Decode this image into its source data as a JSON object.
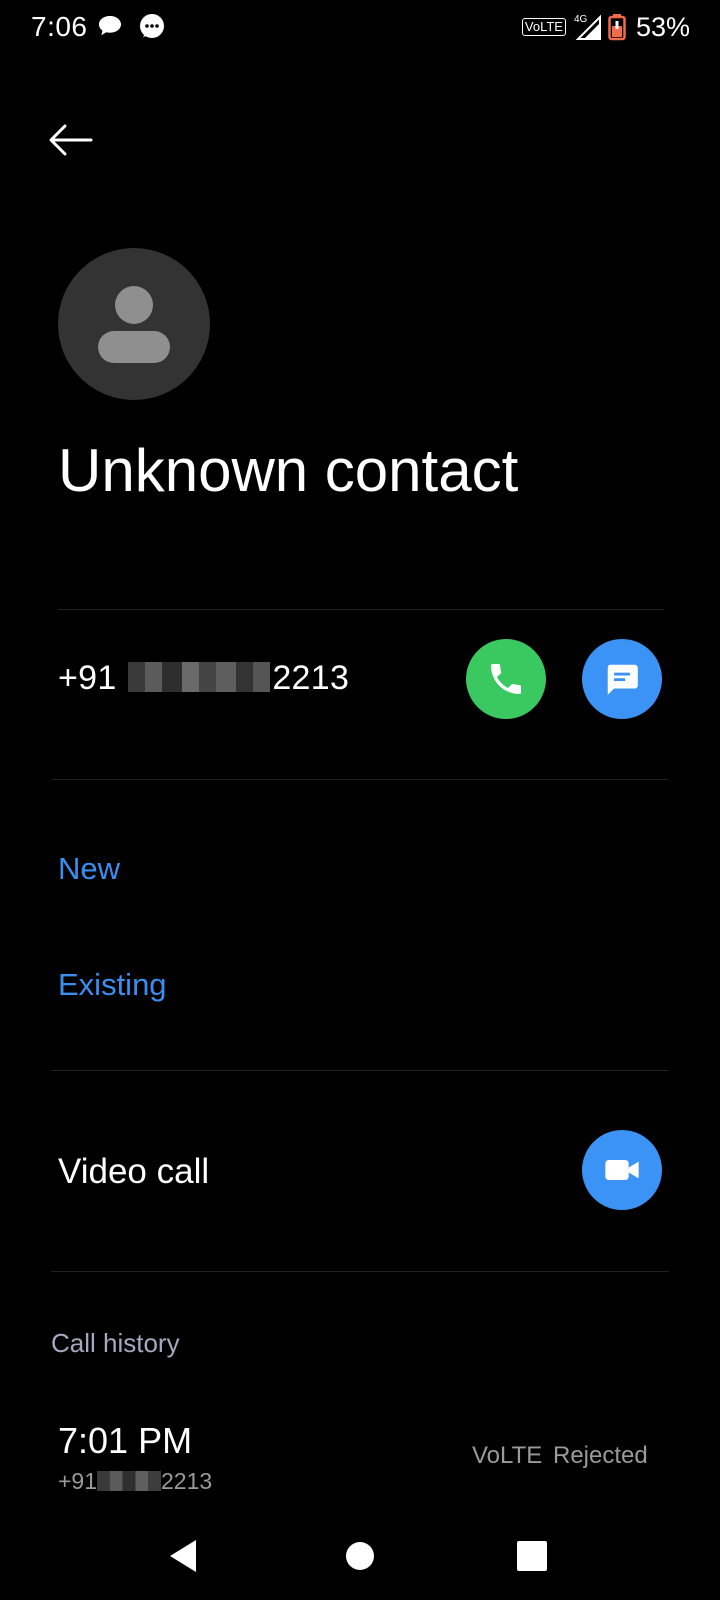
{
  "status_bar": {
    "time": "7:06",
    "network": "VoLTE",
    "network_gen": "4G",
    "battery_percent": "53%",
    "battery_level": 0.53,
    "battery_color": "#f26b4c"
  },
  "contact": {
    "name": "Unknown contact",
    "phone_prefix": "+91",
    "phone_suffix": "2213"
  },
  "add_options": {
    "new_label": "New",
    "existing_label": "Existing"
  },
  "video": {
    "label": "Video call"
  },
  "call_history": {
    "section_label": "Call history",
    "entries": [
      {
        "time": "7:01 PM",
        "number_prefix": "+91",
        "number_suffix": "2213",
        "type": "VoLTE",
        "status": "Rejected"
      }
    ]
  },
  "colors": {
    "accent": "#3a8ef0",
    "call_green": "#3ac861",
    "action_blue": "#3b93f5",
    "avatar_bg": "#333333"
  }
}
